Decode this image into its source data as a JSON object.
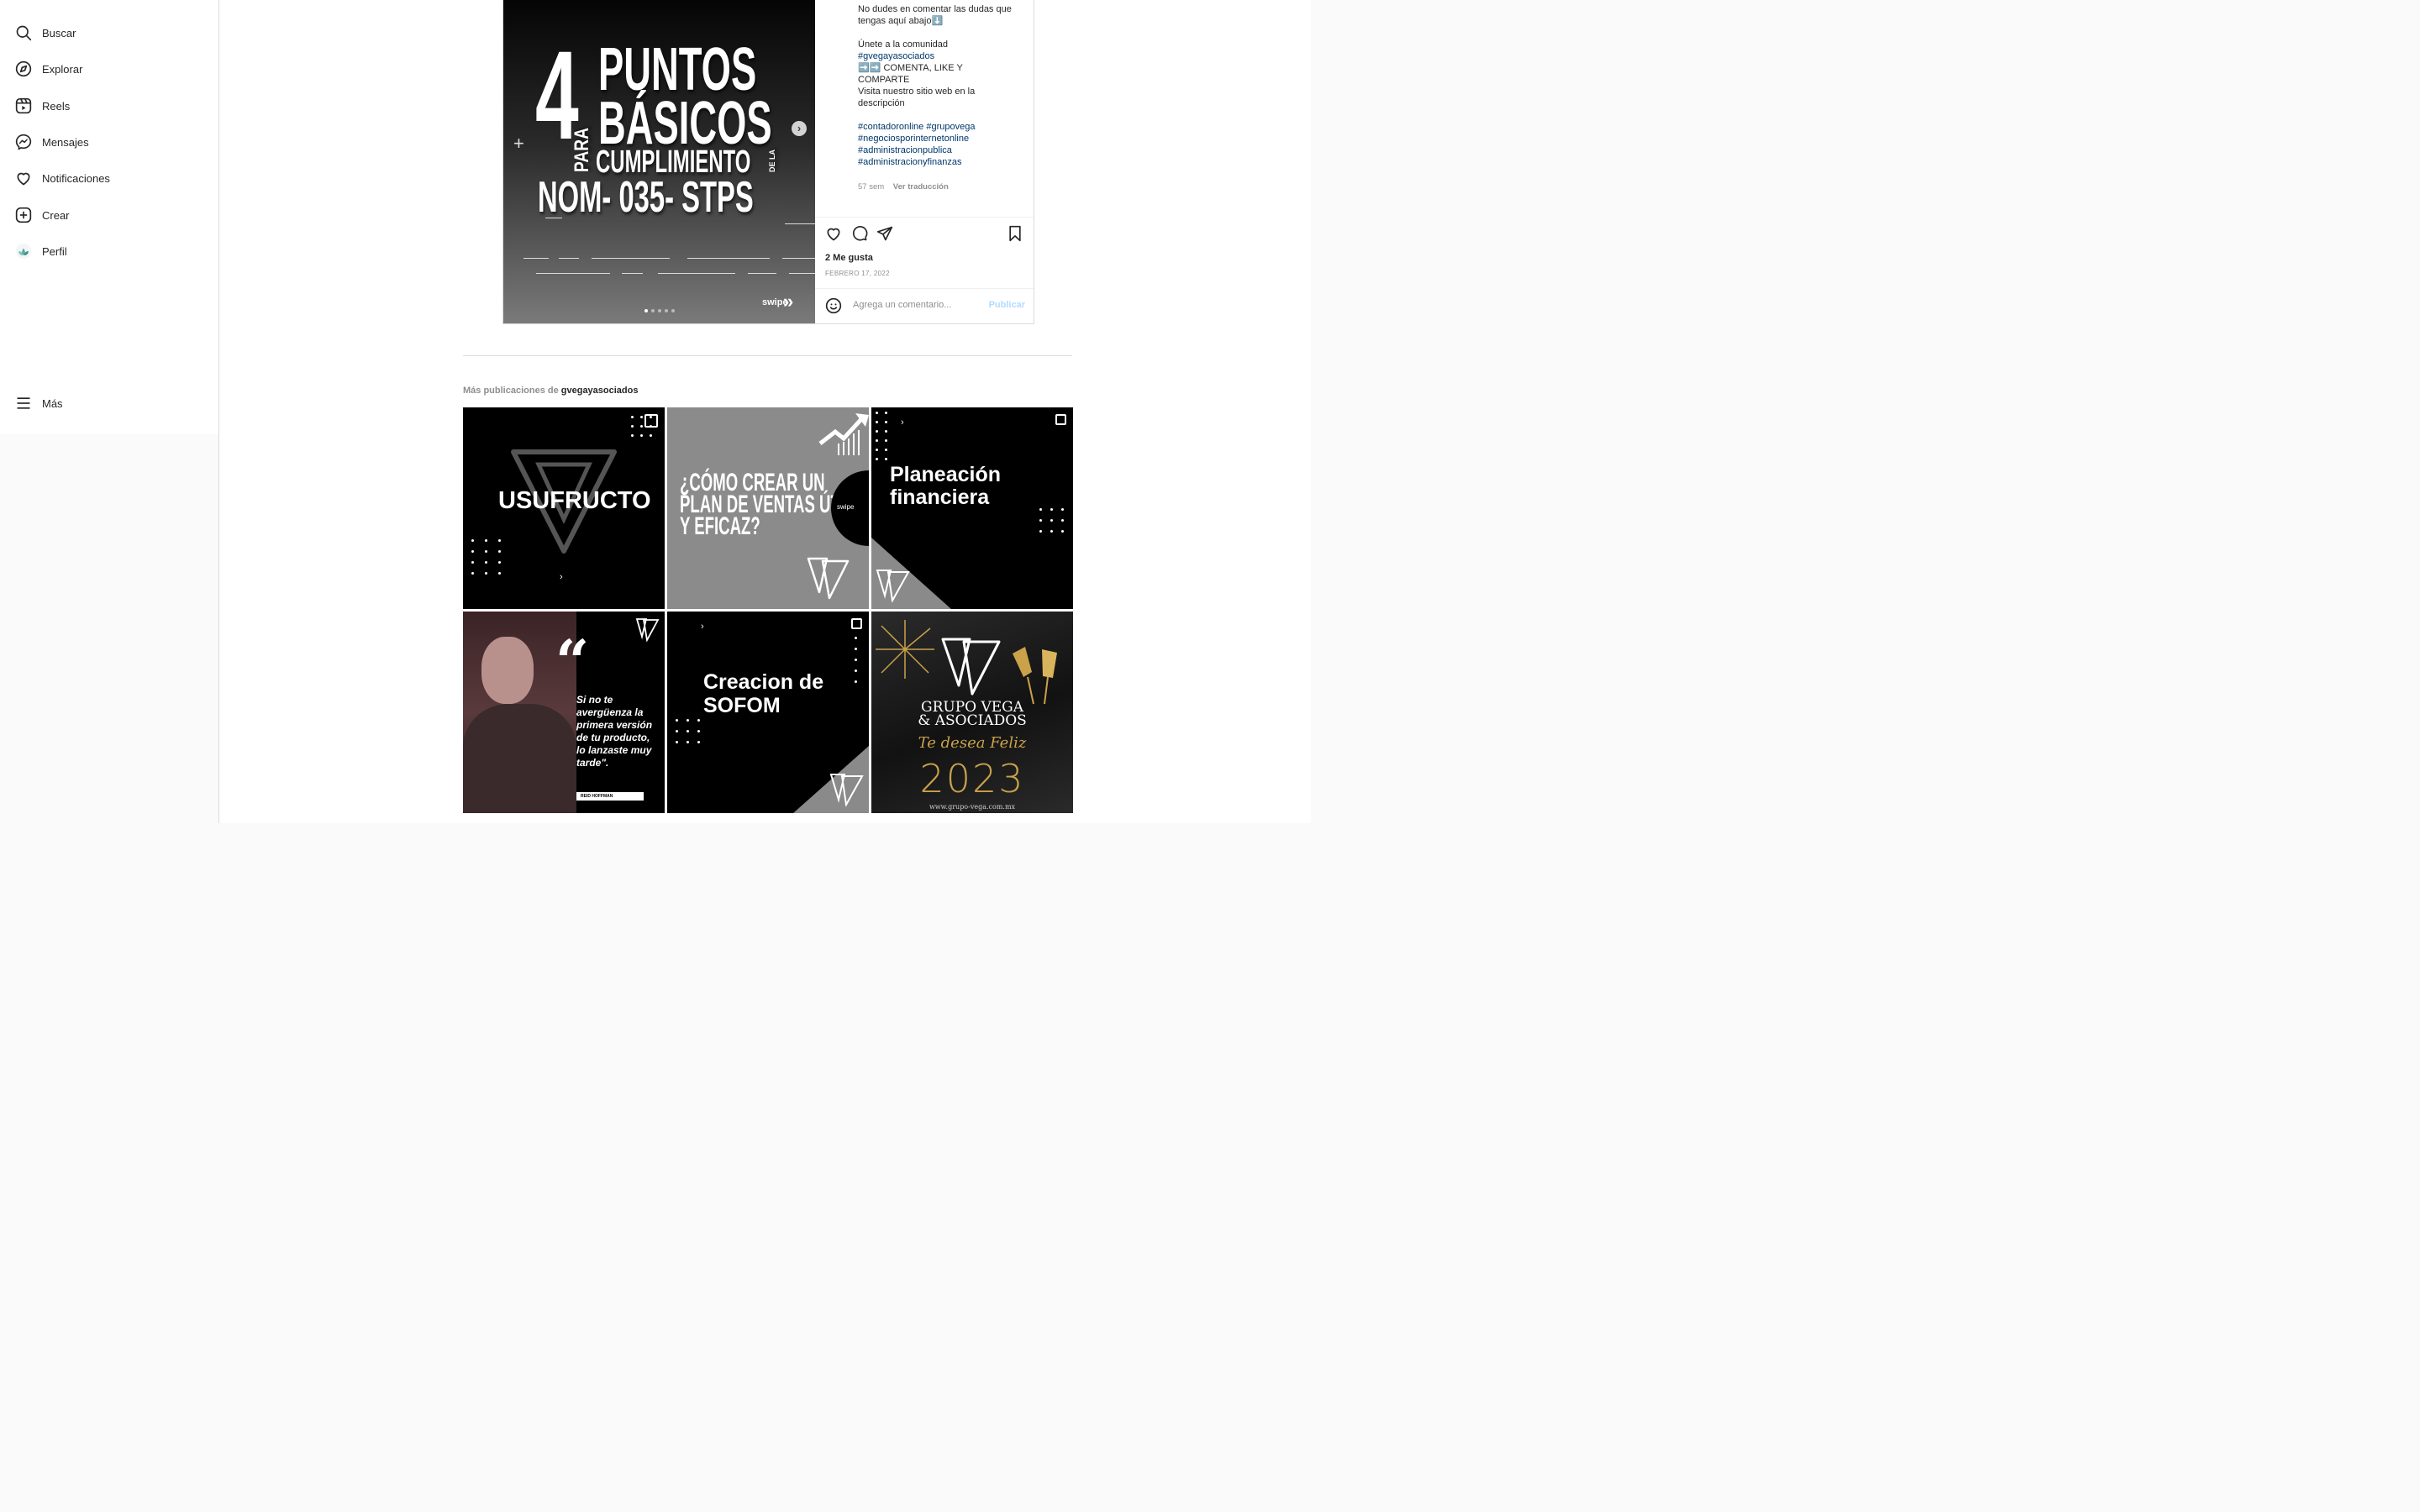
{
  "sidebar": {
    "items": [
      {
        "label": "Buscar",
        "icon": "search-icon"
      },
      {
        "label": "Explorar",
        "icon": "compass-icon"
      },
      {
        "label": "Reels",
        "icon": "reels-icon"
      },
      {
        "label": "Mensajes",
        "icon": "messenger-icon"
      },
      {
        "label": "Notificaciones",
        "icon": "heart-icon"
      },
      {
        "label": "Crear",
        "icon": "plus-square-icon"
      },
      {
        "label": "Perfil",
        "icon": "avatar-icon"
      }
    ],
    "more_label": "Más"
  },
  "post": {
    "image": {
      "number": "4",
      "line1": "PUNTOS",
      "line2": "BÁSICOS",
      "para": "PARA",
      "line3": "CUMPLIMIENTO",
      "dela": "DE LA",
      "line4": "NOM- 035- STPS",
      "swipe": "swipe",
      "slide_count": 5,
      "current_slide": 1
    },
    "caption": {
      "line_a": "No dudes en comentar las dudas que tengas aquí abajo⬇️",
      "line_b": "Únete a la comunidad",
      "tag_community": "#gvegayasociados",
      "line_c": "➡️➡️ COMENTA, LIKE Y COMPARTE",
      "line_d": "Visita nuestro sitio web en la descripción",
      "hashtags": "#contadoronline #grupovega #negociosporinternetonline #administracionpublica #administracionyfinanzas"
    },
    "age": "57 sem",
    "translate_label": "Ver traducción",
    "likes": "2 Me gusta",
    "date": "FEBRERO 17, 2022",
    "comment_placeholder": "Agrega un comentario...",
    "publish_label": "Publicar"
  },
  "more": {
    "prefix": "Más publicaciones de",
    "account": "gvegayasociados"
  },
  "grid": {
    "tile1": "USUFRUCTO",
    "tile2_line1": "¿CÓMO CREAR UN",
    "tile2_line2": "PLAN DE VENTAS ÚTIL",
    "tile2_line3": "Y EFICAZ?",
    "tile2_swipe": "swipe",
    "tile3_line1": "Planeación",
    "tile3_line2": "financiera",
    "tile4_quote": "Si no te avergüenza la primera versión de tu producto, lo lanzaste muy tarde\".",
    "tile4_author": "REID HOFFMAN",
    "tile5_line1": "Creacion de",
    "tile5_line2": "SOFOM",
    "tile6_brand1": "GRUPO VEGA",
    "tile6_brand2": "& ASOCIADOS",
    "tile6_greeting": "Te desea Feliz",
    "tile6_year": "2023",
    "tile6_url": "www.grupo-vega.com.mx"
  },
  "colors": {
    "accent_link": "#00376b",
    "publish_disabled": "#b3dbff",
    "muted": "#8e8e8e",
    "gold": "#c9a24a"
  }
}
